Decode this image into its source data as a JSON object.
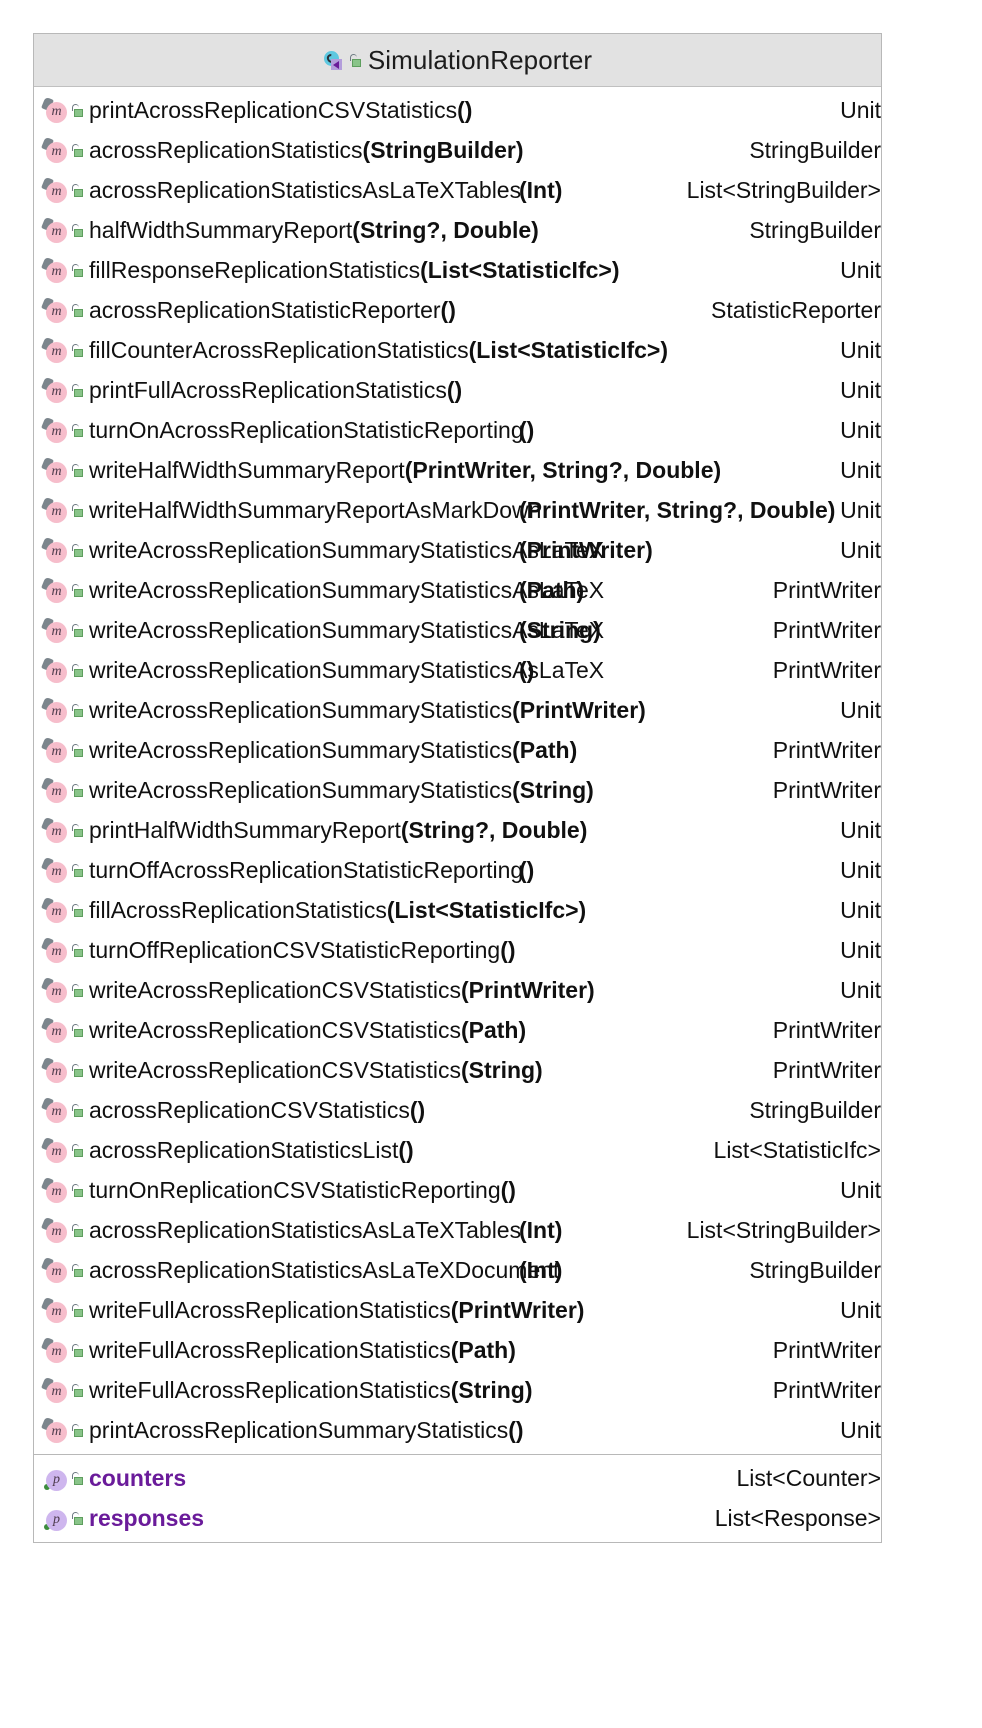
{
  "header": {
    "title": "SimulationReporter",
    "class_icon": "kotlin-class-icon",
    "visibility_icon": "unlocked-public-icon"
  },
  "methods_section": {
    "name": "methods-section",
    "rows": [
      {
        "icon": "method-icon",
        "visibility": "public-icon",
        "name": "printAcrossReplicationCSVStatistics",
        "params": "()",
        "return": "Unit"
      },
      {
        "icon": "method-icon",
        "visibility": "public-icon",
        "name": "acrossReplicationStatistics",
        "params": "(StringBuilder)",
        "return": "StringBuilder"
      },
      {
        "icon": "method-icon",
        "visibility": "public-icon",
        "name": "acrossReplicationStatisticsAsLaTeXTables",
        "params": "(Int)",
        "return": "List<StringBuilder>"
      },
      {
        "icon": "method-icon",
        "visibility": "public-icon",
        "name": "halfWidthSummaryReport",
        "params": "(String?, Double)",
        "return": "StringBuilder"
      },
      {
        "icon": "method-icon",
        "visibility": "public-icon",
        "name": "fillResponseReplicationStatistics",
        "params": "(List<StatisticIfc>)",
        "return": "Unit"
      },
      {
        "icon": "method-icon",
        "visibility": "public-icon",
        "name": "acrossReplicationStatisticReporter",
        "params": "()",
        "return": "StatisticReporter"
      },
      {
        "icon": "method-icon",
        "visibility": "public-icon",
        "name": "fillCounterAcrossReplicationStatistics",
        "params": "(List<StatisticIfc>)",
        "return": "Unit"
      },
      {
        "icon": "method-icon",
        "visibility": "public-icon",
        "name": "printFullAcrossReplicationStatistics",
        "params": "()",
        "return": "Unit"
      },
      {
        "icon": "method-icon",
        "visibility": "public-icon",
        "name": "turnOnAcrossReplicationStatisticReporting",
        "params": "()",
        "return": "Unit"
      },
      {
        "icon": "method-icon",
        "visibility": "public-icon",
        "name": "writeHalfWidthSummaryReport",
        "params": "(PrintWriter, String?, Double)",
        "return": "Unit"
      },
      {
        "icon": "method-icon",
        "visibility": "public-icon",
        "name": "writeHalfWidthSummaryReportAsMarkDown",
        "params": "(PrintWriter, String?, Double)",
        "return": "Unit"
      },
      {
        "icon": "method-icon",
        "visibility": "public-icon",
        "name": "writeAcrossReplicationSummaryStatisticsAsLaTeX",
        "params": "(PrintWriter)",
        "return": "Unit"
      },
      {
        "icon": "method-icon",
        "visibility": "public-icon",
        "name": "writeAcrossReplicationSummaryStatisticsAsLaTeX",
        "params": "(Path)",
        "return": "PrintWriter"
      },
      {
        "icon": "method-icon",
        "visibility": "public-icon",
        "name": "writeAcrossReplicationSummaryStatisticsAsLaTeX",
        "params": "(String)",
        "return": "PrintWriter"
      },
      {
        "icon": "method-icon",
        "visibility": "public-icon",
        "name": "writeAcrossReplicationSummaryStatisticsAsLaTeX",
        "params": "()",
        "return": "PrintWriter"
      },
      {
        "icon": "method-icon",
        "visibility": "public-icon",
        "name": "writeAcrossReplicationSummaryStatistics",
        "params": "(PrintWriter)",
        "return": "Unit"
      },
      {
        "icon": "method-icon",
        "visibility": "public-icon",
        "name": "writeAcrossReplicationSummaryStatistics",
        "params": "(Path)",
        "return": "PrintWriter"
      },
      {
        "icon": "method-icon",
        "visibility": "public-icon",
        "name": "writeAcrossReplicationSummaryStatistics",
        "params": "(String)",
        "return": "PrintWriter"
      },
      {
        "icon": "method-icon",
        "visibility": "public-icon",
        "name": "printHalfWidthSummaryReport",
        "params": "(String?, Double)",
        "return": "Unit"
      },
      {
        "icon": "method-icon",
        "visibility": "public-icon",
        "name": "turnOffAcrossReplicationStatisticReporting",
        "params": "()",
        "return": "Unit"
      },
      {
        "icon": "method-icon",
        "visibility": "public-icon",
        "name": "fillAcrossReplicationStatistics",
        "params": "(List<StatisticIfc>)",
        "return": "Unit"
      },
      {
        "icon": "method-icon",
        "visibility": "public-icon",
        "name": "turnOffReplicationCSVStatisticReporting",
        "params": "()",
        "return": "Unit"
      },
      {
        "icon": "method-icon",
        "visibility": "public-icon",
        "name": "writeAcrossReplicationCSVStatistics",
        "params": "(PrintWriter)",
        "return": "Unit"
      },
      {
        "icon": "method-icon",
        "visibility": "public-icon",
        "name": "writeAcrossReplicationCSVStatistics",
        "params": "(Path)",
        "return": "PrintWriter"
      },
      {
        "icon": "method-icon",
        "visibility": "public-icon",
        "name": "writeAcrossReplicationCSVStatistics",
        "params": "(String)",
        "return": "PrintWriter"
      },
      {
        "icon": "method-icon",
        "visibility": "public-icon",
        "name": "acrossReplicationCSVStatistics",
        "params": "()",
        "return": "StringBuilder"
      },
      {
        "icon": "method-icon",
        "visibility": "public-icon",
        "name": "acrossReplicationStatisticsList",
        "params": "()",
        "return": "List<StatisticIfc>"
      },
      {
        "icon": "method-icon",
        "visibility": "public-icon",
        "name": "turnOnReplicationCSVStatisticReporting",
        "params": "()",
        "return": "Unit"
      },
      {
        "icon": "method-icon",
        "visibility": "public-icon",
        "name": "acrossReplicationStatisticsAsLaTeXTables",
        "params": "(Int)",
        "return": "List<StringBuilder>"
      },
      {
        "icon": "method-icon",
        "visibility": "public-icon",
        "name": "acrossReplicationStatisticsAsLaTeXDocument",
        "params": "(Int)",
        "return": "StringBuilder"
      },
      {
        "icon": "method-icon",
        "visibility": "public-icon",
        "name": "writeFullAcrossReplicationStatistics",
        "params": "(PrintWriter)",
        "return": "Unit"
      },
      {
        "icon": "method-icon",
        "visibility": "public-icon",
        "name": "writeFullAcrossReplicationStatistics",
        "params": "(Path)",
        "return": "PrintWriter"
      },
      {
        "icon": "method-icon",
        "visibility": "public-icon",
        "name": "writeFullAcrossReplicationStatistics",
        "params": "(String)",
        "return": "PrintWriter"
      },
      {
        "icon": "method-icon",
        "visibility": "public-icon",
        "name": "printAcrossReplicationSummaryStatistics",
        "params": "()",
        "return": "Unit"
      }
    ]
  },
  "properties_section": {
    "name": "properties-section",
    "rows": [
      {
        "icon": "property-icon",
        "visibility": "public-icon",
        "name": "counters",
        "params": "",
        "return": "List<Counter>"
      },
      {
        "icon": "property-icon",
        "visibility": "public-icon",
        "name": "responses",
        "params": "",
        "return": "List<Response>"
      }
    ]
  },
  "colors": {
    "method_icon_bg": "#f6bdcb",
    "property_icon_bg": "#ceb6ee",
    "property_name_text": "#6a1b9a",
    "header_bg": "#e2e2e2",
    "border": "#b8b8b8"
  }
}
